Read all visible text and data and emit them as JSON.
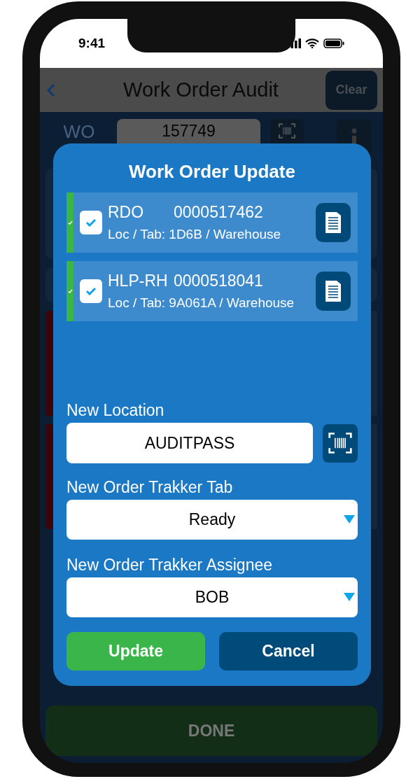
{
  "status_bar": {
    "time": "9:41"
  },
  "nav_bar": {
    "title": "Work Order Audit",
    "clear_button": "Clear"
  },
  "form": {
    "wo_label": "WO",
    "wo_value": "157749"
  },
  "done_button": "DONE",
  "modal": {
    "title": "Work Order Update",
    "orders": [
      {
        "type": "RDO",
        "number": "0000517462",
        "location": "Loc / Tab: 1D6B / Warehouse",
        "checked": true
      },
      {
        "type": "HLP-RH",
        "number": "0000518041",
        "location": "Loc / Tab: 9A061A / Warehouse",
        "checked": true
      }
    ],
    "new_location": {
      "label": "New Location",
      "value": "AUDITPASS"
    },
    "order_tab": {
      "label": "New Order Trakker Tab",
      "value": "Ready"
    },
    "assignee": {
      "label": "New Order Trakker Assignee",
      "value": "BOB"
    },
    "buttons": [
      {
        "kind": "primary",
        "label": "Update"
      },
      {
        "kind": "secondary",
        "label": "Cancel"
      }
    ]
  }
}
